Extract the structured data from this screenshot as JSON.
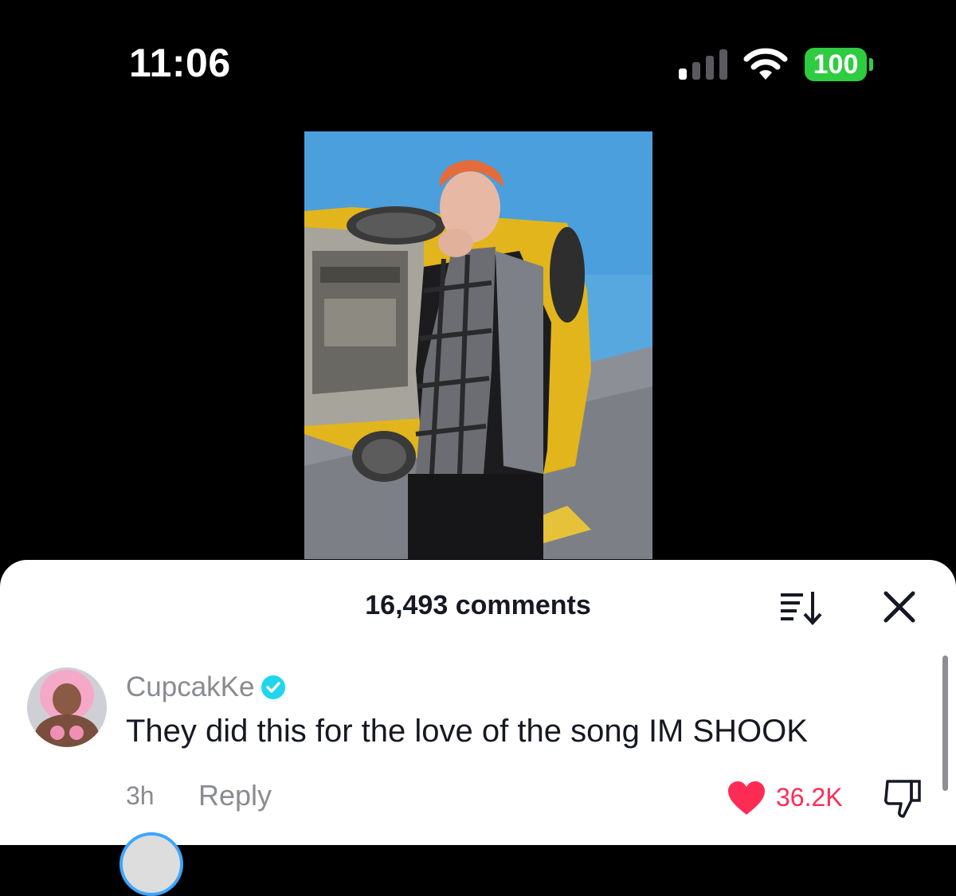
{
  "status_bar": {
    "time": "11:06",
    "battery": "100",
    "signal_icon": "cellular-signal-icon",
    "wifi_icon": "wifi-icon"
  },
  "video": {
    "description_icon": "video-thumbnail"
  },
  "comments_sheet": {
    "count_label": "16,493 comments",
    "sort_icon": "sort-icon",
    "close_icon": "close-icon"
  },
  "comments": [
    {
      "username": "CupcakKe",
      "verified": true,
      "text": "They did this for the love of the song IM SHOOK",
      "time": "3h",
      "reply_label": "Reply",
      "likes": "36.2K",
      "liked": true
    }
  ],
  "colors": {
    "like": "#fe2c55",
    "verified": "#20d5ec",
    "battery": "#2ecc40"
  }
}
